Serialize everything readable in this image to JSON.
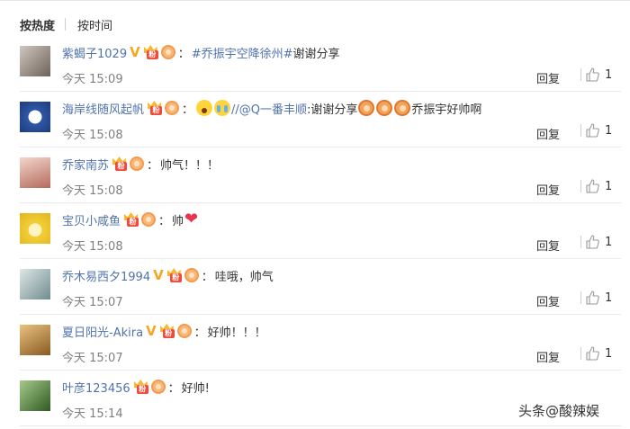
{
  "sort": {
    "hot_label": "按热度",
    "time_label": "按时间"
  },
  "reply_label": "回复",
  "watermark": "头条@酸辣娱",
  "comments": [
    {
      "username": "紫蝎子1029",
      "verified_v": "V",
      "segments": [
        {
          "type": "link",
          "text": "#乔振宇空降徐州#"
        },
        {
          "type": "text",
          "text": " 谢谢分享"
        }
      ],
      "time": "今天 15:09",
      "likes": "1",
      "avatar_color": "#9a8f86"
    },
    {
      "username": "海岸线随风起帆",
      "segments": [
        {
          "type": "link",
          "text": "//@Q一番丰顺"
        },
        {
          "type": "text",
          "text": ":谢谢分享"
        },
        {
          "type": "text",
          "text": "乔振宇好帅啊"
        }
      ],
      "time": "今天 15:08",
      "likes": "1",
      "avatar_color": "#3b5aa8"
    },
    {
      "username": "乔家南苏",
      "segments": [
        {
          "type": "text",
          "text": "帅气！！！"
        }
      ],
      "time": "今天 15:08",
      "likes": "1",
      "avatar_color": "#c98a7c"
    },
    {
      "username": "宝贝小咸鱼",
      "segments": [
        {
          "type": "text",
          "text": "帅"
        }
      ],
      "time": "今天 15:08",
      "likes": "1",
      "avatar_color": "#f2cf3a"
    },
    {
      "username": "乔木易西夕1994",
      "verified_v": "V",
      "segments": [
        {
          "type": "text",
          "text": "哇哦，帅气"
        }
      ],
      "time": "今天 15:07",
      "likes": "1",
      "avatar_color": "#8fa3a6"
    },
    {
      "username": "夏日阳光-Akira",
      "verified_v": "V",
      "segments": [
        {
          "type": "text",
          "text": "好帅！！！"
        }
      ],
      "time": "今天 15:07",
      "likes": "1",
      "avatar_color": "#b8863d"
    },
    {
      "username": "叶彦123456",
      "segments": [
        {
          "type": "text",
          "text": "好帅!"
        }
      ],
      "time": "今天 15:14",
      "likes": "",
      "avatar_color": "#4d7a3a"
    }
  ],
  "colors": {
    "link": "#5173ad",
    "accent_orange": "#f5a623",
    "like_icon": "#999999"
  },
  "icons": {
    "like": "thumbs-up-icon",
    "heart": "heart-emoji"
  }
}
